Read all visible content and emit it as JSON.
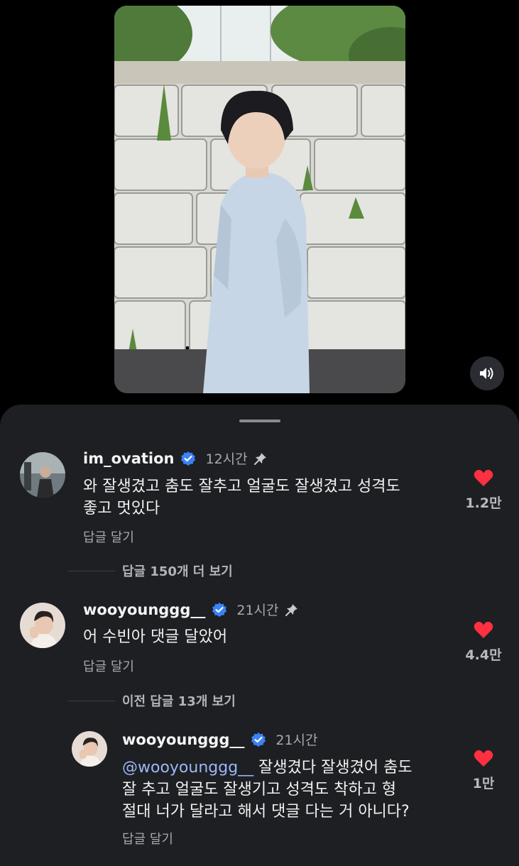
{
  "colors": {
    "background": "#000000",
    "sheet": "#1e1f23",
    "like": "#ff3040",
    "verified": "#3b82f6",
    "muted_text": "#a7a8ad"
  },
  "video": {
    "mute_icon": "speaker-icon"
  },
  "comments": [
    {
      "username": "im_ovation",
      "verified": true,
      "time": "12시간",
      "pinned": true,
      "text": "와 잘생겼고 춤도 잘추고 얼굴도 잘생겼고 성격도\n좋고 멋있다",
      "reply_label": "답글 달기",
      "likes": "1.2만",
      "more_replies": "답글 150개 더 보기"
    },
    {
      "username": "wooyounggg__",
      "verified": true,
      "time": "21시간",
      "pinned": true,
      "text": "어 수빈아 댓글 달았어",
      "reply_label": "답글 달기",
      "likes": "4.4만",
      "more_replies": "이전 답글 13개 보기"
    }
  ],
  "reply": {
    "username": "wooyounggg__",
    "verified": true,
    "time": "21시간",
    "mention": "@wooyounggg__",
    "text": " 잘생겼다 잘생겼어 춤도\n잘 추고 얼굴도 잘생기고 성격도 착하고 형\n절대 너가 달라고 해서 댓글 다는 거 아니다?",
    "reply_label": "답글 달기",
    "likes": "1만"
  }
}
